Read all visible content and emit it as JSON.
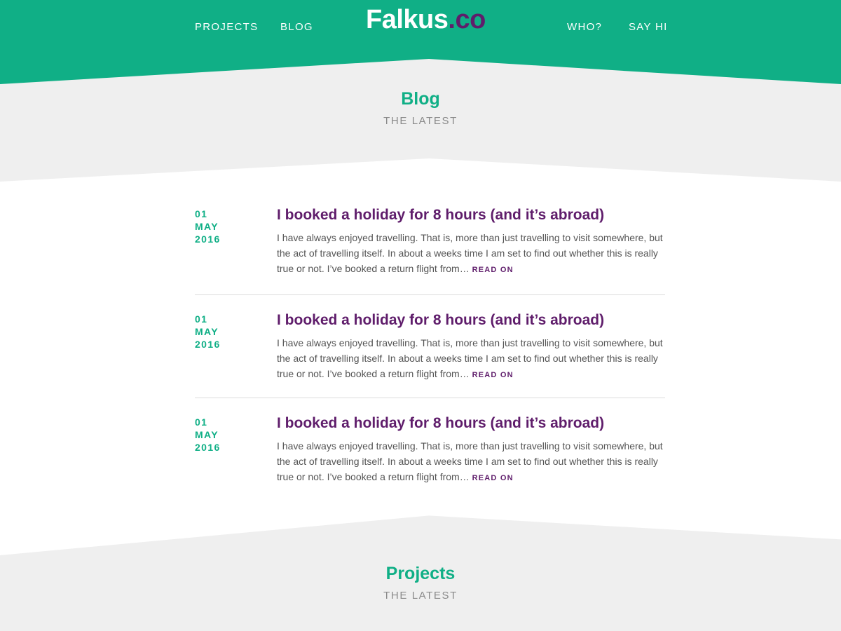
{
  "header": {
    "nav_left": [
      "PROJECTS",
      "BLOG"
    ],
    "nav_right": [
      "WHO?",
      "SAY HI"
    ],
    "logo_main": "Falkus",
    "logo_tld": ".co"
  },
  "blog_section": {
    "title": "Blog",
    "subtitle": "THE LATEST"
  },
  "posts": [
    {
      "day": "01",
      "month": "MAY",
      "year": "2016",
      "title": "I booked a holiday for 8 hours (and it’s abroad)",
      "excerpt": "I have always enjoyed travelling. That is, more than just travelling to visit some­where, but the act of travelling itself. In about a weeks time I am set to find out whether this is really true or not. I’ve booked a return flight from…",
      "read_on": "READ ON"
    },
    {
      "day": "01",
      "month": "MAY",
      "year": "2016",
      "title": "I booked a holiday for 8 hours (and it’s abroad)",
      "excerpt": "I have always enjoyed travelling. That is, more than just travelling to visit some­where, but the act of travelling itself. In about a weeks time I am set to find out whether this is really true or not. I’ve booked a return flight from…",
      "read_on": "READ ON"
    },
    {
      "day": "01",
      "month": "MAY",
      "year": "2016",
      "title": "I booked a holiday for 8 hours (and it’s abroad)",
      "excerpt": "I have always enjoyed travelling. That is, more than just travelling to visit some­where, but the act of travelling itself. In about a weeks time I am set to find out whether this is really true or not. I’ve booked a return flight from…",
      "read_on": "READ ON"
    }
  ],
  "projects_section": {
    "title": "Projects",
    "subtitle": "THE LATEST"
  },
  "colors": {
    "brand_green": "#10af86",
    "brand_purple": "#5f1d6b",
    "band_grey": "#efefef"
  }
}
